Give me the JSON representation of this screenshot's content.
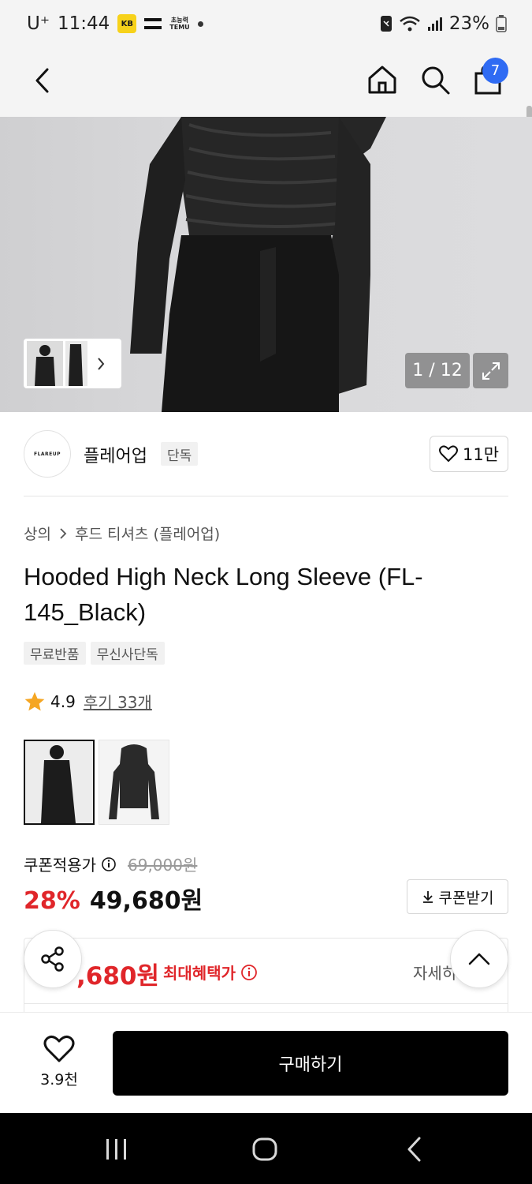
{
  "status_bar": {
    "carrier": "U⁺",
    "time": "11:44",
    "kakao_icon": "kb-icon",
    "temu_label": "TEMU",
    "battery": "23%"
  },
  "header": {
    "cart_count": "7"
  },
  "gallery": {
    "page_indicator": "1 / 12"
  },
  "brand": {
    "logo_text": "FLAREUP",
    "name": "플레어업",
    "tag": "단독",
    "likes": "11만"
  },
  "product": {
    "breadcrumb": [
      "상의",
      "후드 티셔츠 (플레어업)"
    ],
    "title": "Hooded High Neck Long Sleeve (FL-145_Black)",
    "tags": [
      "무료반품",
      "무신사단독"
    ],
    "rating": "4.9",
    "review_link": "후기 33개",
    "rating_color": "#f5a623"
  },
  "price": {
    "coupon_label": "쿠폰적용가",
    "original": "69,000원",
    "discount": "28%",
    "current": "49,680원",
    "coupon_button": "쿠폰받기",
    "accent_color": "#e0262a"
  },
  "benefit": {
    "max_price": ",680원",
    "label": "최대혜택가",
    "detail": "자세히"
  },
  "purchase_bar": {
    "wish_count": "3.9천",
    "buy_label": "구매하기"
  }
}
